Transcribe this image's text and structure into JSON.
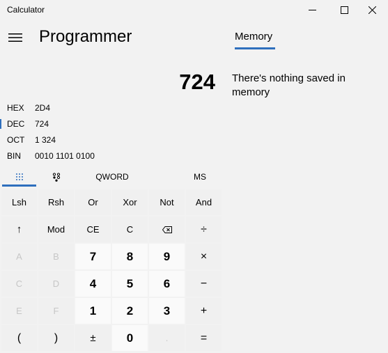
{
  "window": {
    "title": "Calculator"
  },
  "header": {
    "mode": "Programmer",
    "memory_tab": "Memory",
    "memory_empty": "There's nothing saved in memory"
  },
  "display": {
    "value": "724"
  },
  "bases": [
    {
      "label": "HEX",
      "value": "2D4",
      "selected": false
    },
    {
      "label": "DEC",
      "value": "724",
      "selected": true
    },
    {
      "label": "OCT",
      "value": "1 324",
      "selected": false
    },
    {
      "label": "BIN",
      "value": "0010 1101 0100",
      "selected": false
    }
  ],
  "toolbar": {
    "word_size": "QWORD",
    "memory_store": "MS"
  },
  "keys": {
    "lsh": "Lsh",
    "rsh": "Rsh",
    "or": "Or",
    "xor": "Xor",
    "not": "Not",
    "and": "And",
    "shift": "↑",
    "mod": "Mod",
    "ce": "CE",
    "c": "C",
    "backspace": "⌫",
    "divide": "÷",
    "a": "A",
    "b": "B",
    "seven": "7",
    "eight": "8",
    "nine": "9",
    "multiply": "×",
    "c_hex": "C",
    "d": "D",
    "four": "4",
    "five": "5",
    "six": "6",
    "minus": "−",
    "e": "E",
    "f": "F",
    "one": "1",
    "two": "2",
    "three": "3",
    "plus": "+",
    "lparen": "(",
    "rparen": ")",
    "negate": "±",
    "zero": "0",
    "decimal": ".",
    "equals": "="
  },
  "colors": {
    "accent": "#2e6fbd",
    "background": "#f2f2f2"
  }
}
